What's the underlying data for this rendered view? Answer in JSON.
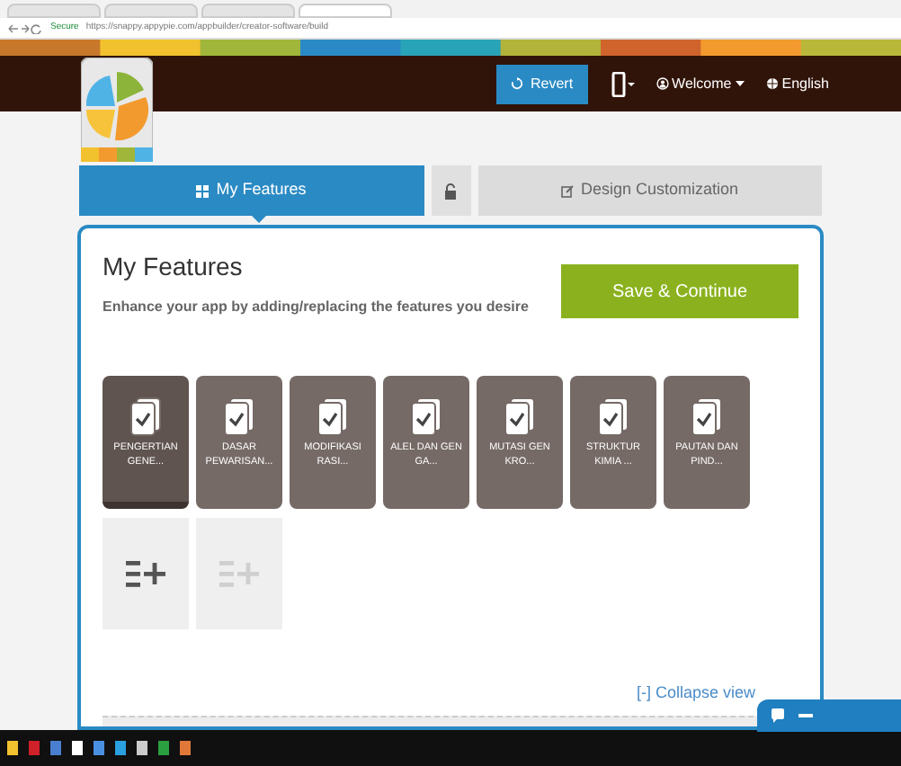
{
  "browser": {
    "tabs": [
      {
        "selected": false
      },
      {
        "selected": false
      },
      {
        "selected": false
      },
      {
        "selected": true
      }
    ],
    "address": "https://snappy.appypie.com/appbuilder/creator-software/build",
    "secure_label": "Secure"
  },
  "header": {
    "revert": "Revert",
    "welcome": "Welcome",
    "language": "English"
  },
  "steps": [
    {
      "label": "My Features",
      "selected": true
    },
    {
      "label": "Design Customization",
      "selected": false
    }
  ],
  "panel": {
    "title": "My Features",
    "subtitle": "Enhance your app by adding/replacing the features you desire",
    "save_button": "Save & Continue"
  },
  "features": [
    {
      "label": "PENGERTIAN GENE...",
      "selected": true
    },
    {
      "label": "DASAR PEWARISAN...",
      "selected": false
    },
    {
      "label": "MODIFIKASI RASI...",
      "selected": false
    },
    {
      "label": "ALEL DAN GEN GA...",
      "selected": false
    },
    {
      "label": "MUTASI GEN KRO...",
      "selected": false
    },
    {
      "label": "STRUKTUR KIMIA ...",
      "selected": false
    },
    {
      "label": "PAUTAN DAN PIND...",
      "selected": false
    }
  ],
  "add_tiles": [
    {
      "disabled": false
    },
    {
      "disabled": true
    }
  ],
  "collapse_link": "[-] Collapse view"
}
